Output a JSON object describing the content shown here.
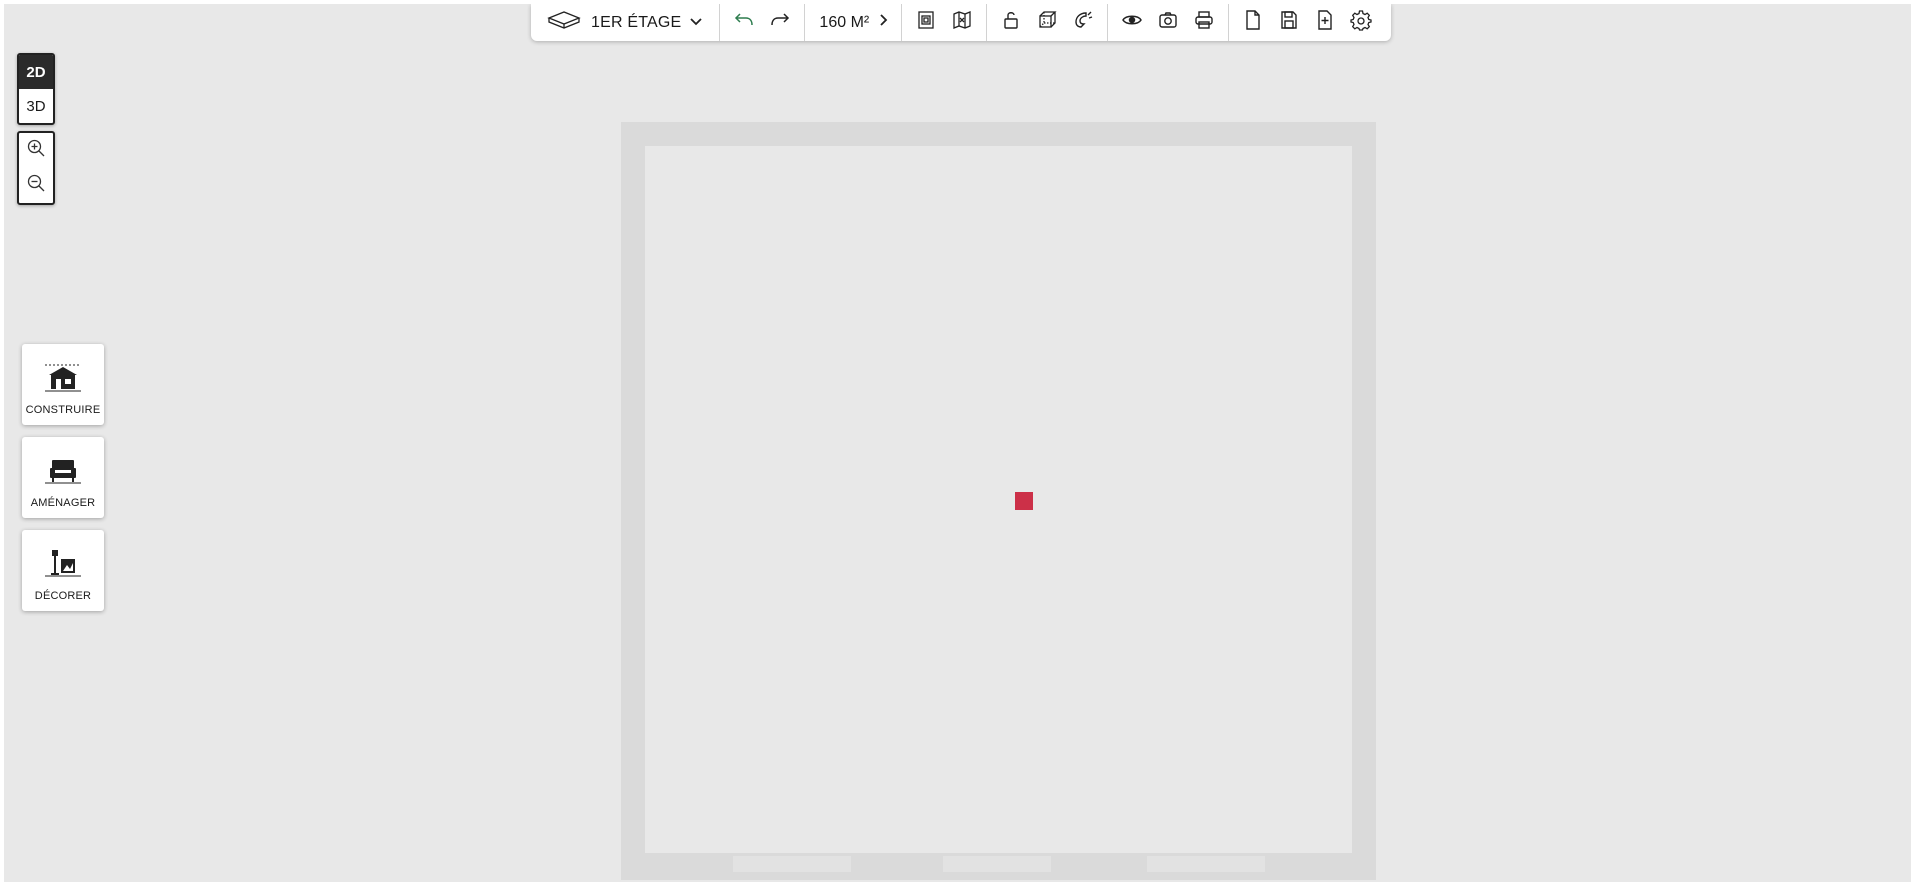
{
  "toolbar": {
    "floor_label": "1ER ÉTAGE",
    "area_label": "160 M²",
    "icons": {
      "floor": "floor-plane-icon",
      "dropdown": "chevron-down-icon",
      "undo": "undo-icon",
      "redo": "redo-icon",
      "area_next": "chevron-right-icon",
      "plan_doc": "plan-document-icon",
      "map": "map-icon",
      "lock": "unlock-icon",
      "cube": "cube-icon",
      "magnet": "magnet-icon",
      "eye": "eye-icon",
      "camera": "camera-icon",
      "print": "printer-icon",
      "new": "new-file-icon",
      "save": "save-icon",
      "add": "add-file-icon",
      "settings": "gear-icon"
    }
  },
  "view_switch": {
    "options": [
      "2D",
      "3D"
    ],
    "active": "2D"
  },
  "zoom": {
    "in_icon": "zoom-in-icon",
    "out_icon": "zoom-out-icon"
  },
  "tools": [
    {
      "label": "CONSTRUIRE",
      "icon": "house-icon"
    },
    {
      "label": "AMÉNAGER",
      "icon": "sofa-icon"
    },
    {
      "label": "DÉCORER",
      "icon": "lamp-frame-icon"
    }
  ],
  "colors": {
    "background": "#e8e8e8",
    "plan_wall": "#dadada",
    "marker": "#cc3048",
    "undo_accent": "#2e7d4f",
    "toolbar_bg": "#ffffff",
    "active_view": "#2b2b2b"
  }
}
